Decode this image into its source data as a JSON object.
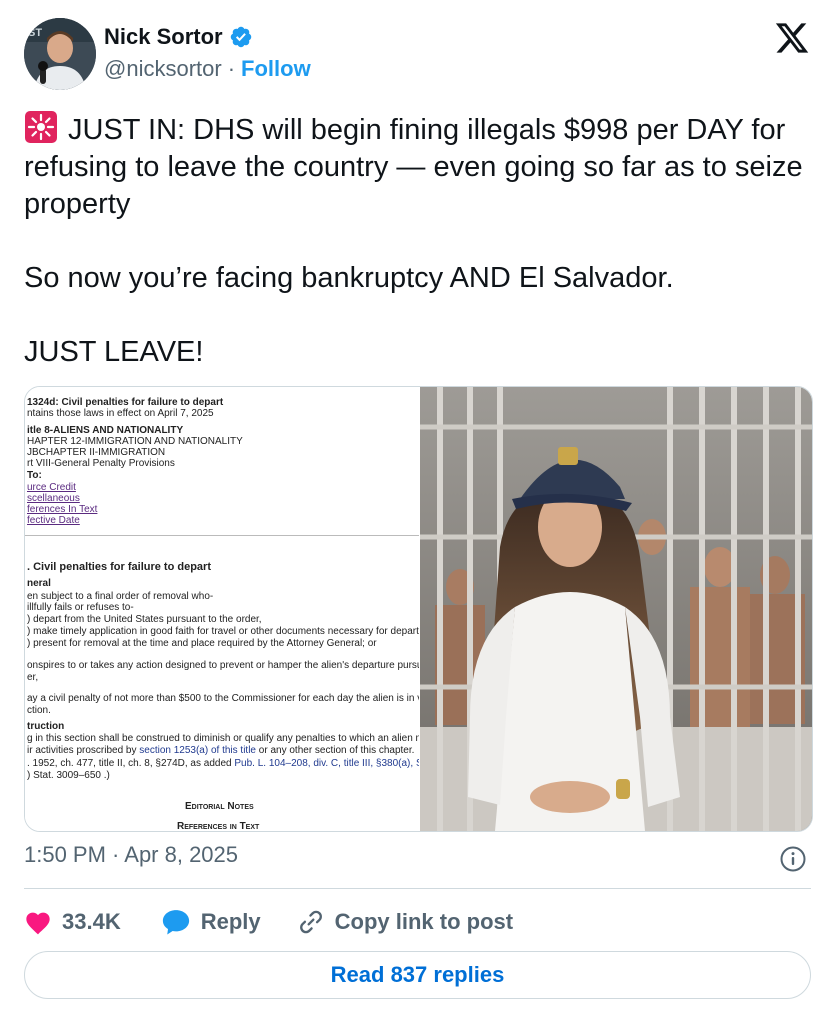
{
  "author": {
    "name": "Nick Sortor",
    "handle": "@nicksortor",
    "separator": "·",
    "follow_label": "Follow"
  },
  "tweet": {
    "line1": "JUST IN: DHS will begin fining illegals $998 per DAY for refusing to leave the country — even going so far as to seize property",
    "line2": "So now you’re facing bankruptcy AND El Salvador.",
    "line3": "JUST LEAVE!"
  },
  "document": {
    "l1": "1324d: Civil penalties for failure to depart",
    "l2": "ntains those laws in effect on April 7, 2025",
    "l3": "itle 8-ALIENS AND NATIONALITY",
    "l4": "HAPTER 12-IMMIGRATION AND NATIONALITY",
    "l5": "JBCHAPTER II-IMMIGRATION",
    "l6": "rt VIII-General Penalty Provisions",
    "l7": "To:",
    "l8": "urce Credit",
    "l9": "scellaneous",
    "l10": "ferences In Text",
    "l11": "fective Date",
    "l12": ". Civil penalties for failure to depart",
    "l13": "neral",
    "l14": "en subject to a final order of removal who-",
    "l15": "illfully fails or refuses to-",
    "l16": ") depart from the United States pursuant to the order,",
    "l17": ") make timely application in good faith for travel or other documents necessary for departu",
    "l18": ") present for removal at the time and place required by the Attorney General; or",
    "l19": "onspires to or takes any action designed to prevent or hamper the alien's departure pursu",
    "l20": "er,",
    "l21": "ay a civil penalty of not more than $500 to the Commissioner for each day the alien is in vi",
    "l22": "ction.",
    "l23": "truction",
    "l24a": "g in this section shall be construed to diminish or qualify any penalties to which an alien m",
    "l25a": "ir activities proscribed by ",
    "l25b": "section 1253(a) of this title",
    "l25c": " or any other section of this chapter.",
    "l26a": ". 1952, ch. 477, title II, ch. 8, §274D, as added ",
    "l26b": "Pub. L. 104–208, div. C, title III, §380(a), S",
    "l27": ") Stat. 3009–650 .)",
    "l28": "Editorial Notes",
    "l29": "References in Text"
  },
  "timestamp": "1:50 PM · Apr 8, 2025",
  "actions": {
    "like_count": "33.4K",
    "reply_label": "Reply",
    "copy_label": "Copy link to post"
  },
  "read_replies_label": "Read 837 replies",
  "colors": {
    "accent": "#1d9bf0",
    "link": "#006fd6",
    "like": "#f91880",
    "muted": "#536471",
    "text": "#0f1419"
  },
  "icons": [
    "verified-badge-icon",
    "x-logo-icon",
    "siren-emoji-icon",
    "info-icon",
    "heart-icon",
    "reply-bubble-icon",
    "link-icon"
  ]
}
